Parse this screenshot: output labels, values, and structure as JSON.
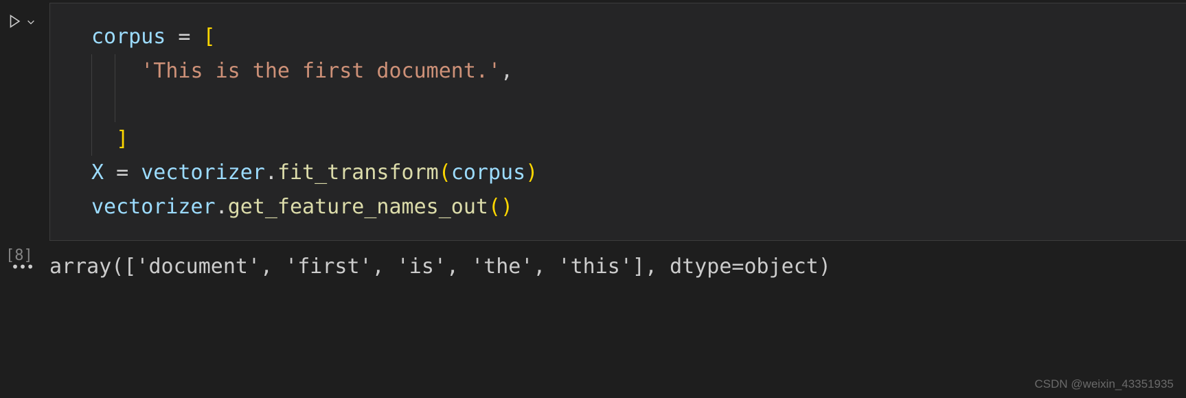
{
  "cell": {
    "exec_count": "[8]",
    "code": {
      "line1": {
        "var": "corpus",
        "op": " = ",
        "bracket": "["
      },
      "line2": {
        "string": "'This is the first document.'",
        "comma": ","
      },
      "line4": {
        "bracket": "]"
      },
      "line5": {
        "var1": "X",
        "op": " = ",
        "var2": "vectorizer",
        "dot": ".",
        "func": "fit_transform",
        "open": "(",
        "arg": "corpus",
        "close": ")"
      },
      "line6": {
        "var": "vectorizer",
        "dot": ".",
        "func": "get_feature_names_out",
        "open": "(",
        "close": ")"
      }
    }
  },
  "output": {
    "text": "array(['document', 'first', 'is', 'the', 'this'], dtype=object)"
  },
  "watermark": "CSDN @weixin_43351935"
}
